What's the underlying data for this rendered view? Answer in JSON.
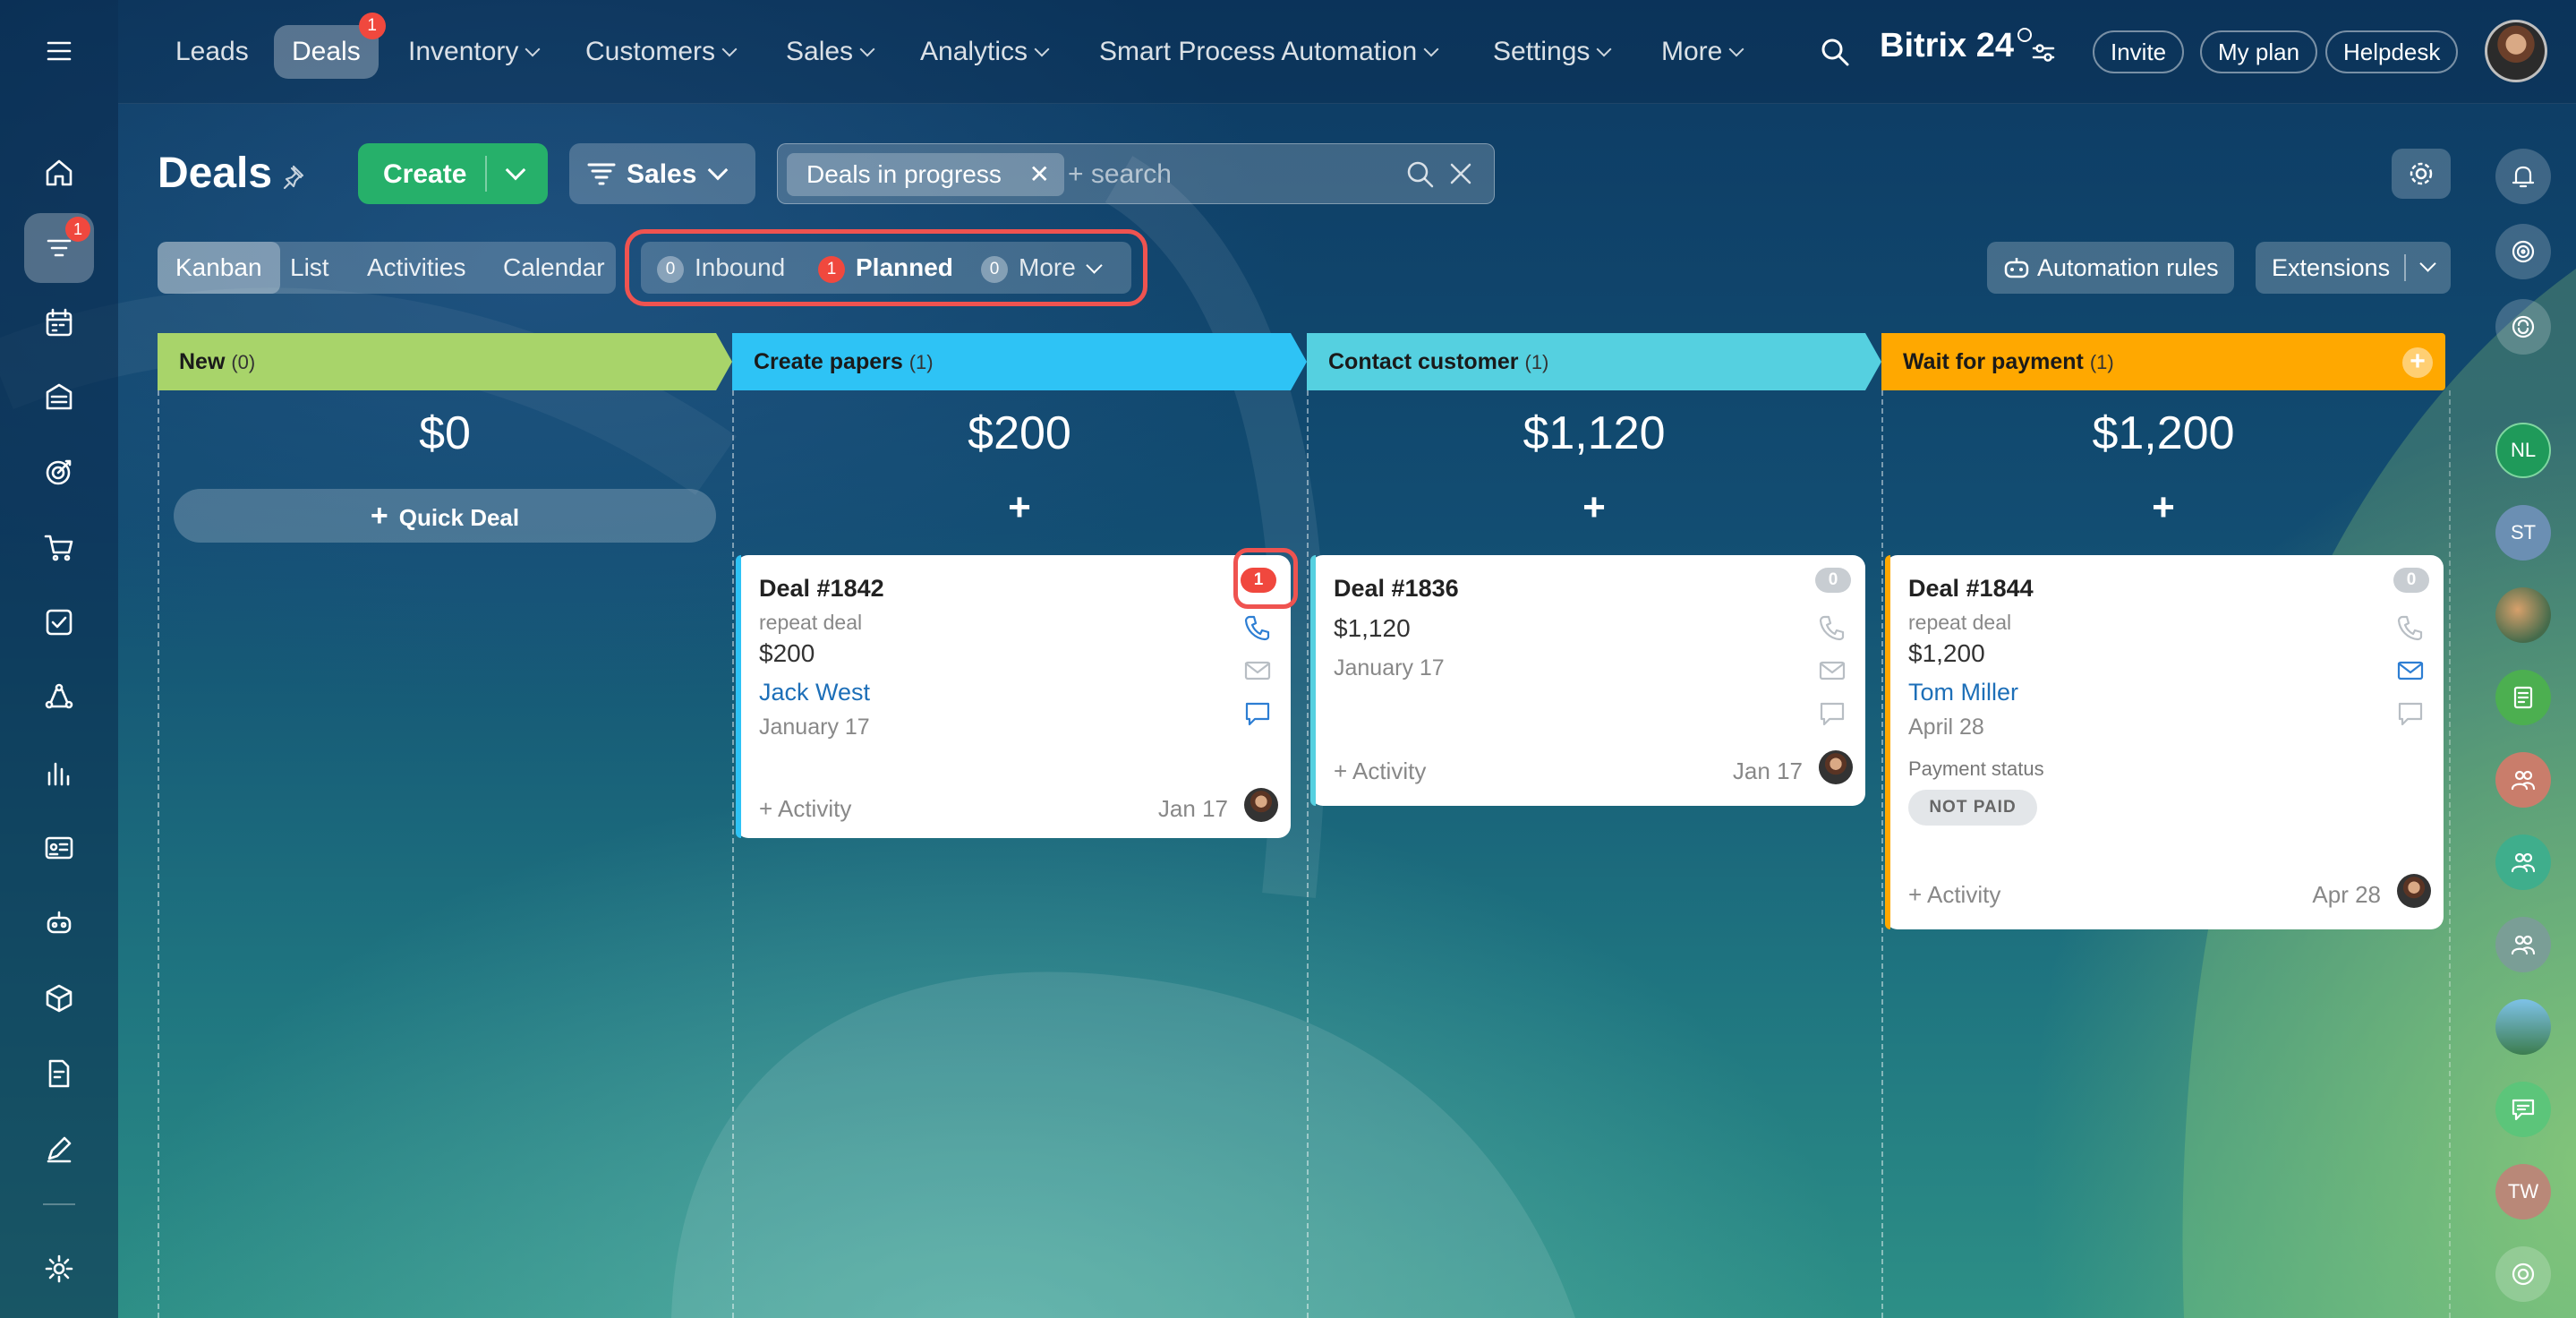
{
  "topnav": {
    "items": [
      {
        "label": "Leads",
        "chevron": false
      },
      {
        "label": "Deals",
        "chevron": false,
        "badge": "1",
        "active": true
      },
      {
        "label": "Inventory",
        "chevron": true
      },
      {
        "label": "Customers",
        "chevron": true
      },
      {
        "label": "Sales",
        "chevron": true
      },
      {
        "label": "Analytics",
        "chevron": true
      },
      {
        "label": "Smart Process Automation",
        "chevron": true
      },
      {
        "label": "Settings",
        "chevron": true
      },
      {
        "label": "More",
        "chevron": true
      }
    ],
    "brand": "Bitrix 24",
    "invite": "Invite",
    "my_plan": "My plan",
    "helpdesk": "Helpdesk"
  },
  "leftbar": {
    "deals_badge": "1"
  },
  "header": {
    "title": "Deals",
    "create_label": "Create",
    "pipeline_label": "Sales",
    "filter_chip": "Deals in progress",
    "search_placeholder": "+ search"
  },
  "views": {
    "tabs": [
      "Kanban",
      "List",
      "Activities",
      "Calendar"
    ],
    "active": "Kanban"
  },
  "counters": {
    "inbound": {
      "count": "0",
      "label": "Inbound"
    },
    "planned": {
      "count": "1",
      "label": "Planned"
    },
    "more": {
      "count": "0",
      "label": "More"
    }
  },
  "toolbar": {
    "automation_label": "Automation rules",
    "extensions_label": "Extensions"
  },
  "columns": [
    {
      "name": "New",
      "count": "(0)",
      "total": "$0",
      "color": "#a8d46a",
      "quick_deal": "Quick Deal"
    },
    {
      "name": "Create papers",
      "count": "(1)",
      "total": "$200",
      "color": "#2ec3f5"
    },
    {
      "name": "Contact customer",
      "count": "(1)",
      "total": "$1,120",
      "color": "#55d0e0"
    },
    {
      "name": "Wait for payment",
      "count": "(1)",
      "total": "$1,200",
      "color": "#ffa800"
    }
  ],
  "cards": {
    "deal1842": {
      "title": "Deal #1842",
      "subtitle": "repeat deal",
      "amount": "$200",
      "contact": "Jack West",
      "date": "January 17",
      "activity": "+ Activity",
      "activity_date": "Jan 17",
      "badge": "1"
    },
    "deal1836": {
      "title": "Deal #1836",
      "amount": "$1,120",
      "date": "January 17",
      "activity": "+ Activity",
      "activity_date": "Jan 17",
      "badge": "0"
    },
    "deal1844": {
      "title": "Deal #1844",
      "subtitle": "repeat deal",
      "amount": "$1,200",
      "contact": "Tom Miller",
      "date": "April 28",
      "payment_label": "Payment status",
      "payment_value": "NOT PAID",
      "activity": "+ Activity",
      "activity_date": "Apr 28",
      "badge": "0"
    }
  },
  "rightbar": {
    "nl": "NL",
    "st": "ST",
    "tw": "TW"
  },
  "colors": {
    "create_green": "#26b06a",
    "badge_red": "#f0483e",
    "highlight_outline": "#ef5350",
    "link_blue": "#1d6fb8"
  }
}
